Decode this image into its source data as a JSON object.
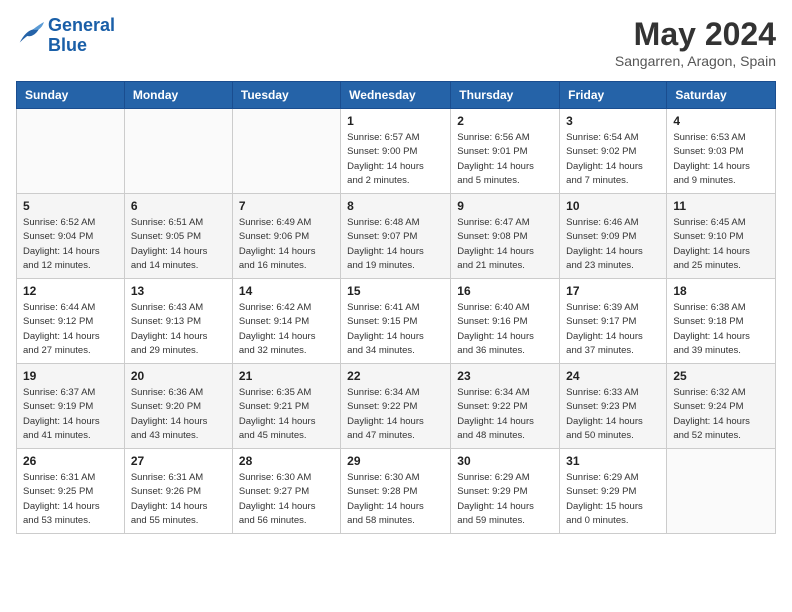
{
  "logo": {
    "line1": "General",
    "line2": "Blue"
  },
  "title": "May 2024",
  "location": "Sangarren, Aragon, Spain",
  "days_header": [
    "Sunday",
    "Monday",
    "Tuesday",
    "Wednesday",
    "Thursday",
    "Friday",
    "Saturday"
  ],
  "weeks": [
    [
      {
        "day": "",
        "info": ""
      },
      {
        "day": "",
        "info": ""
      },
      {
        "day": "",
        "info": ""
      },
      {
        "day": "1",
        "info": "Sunrise: 6:57 AM\nSunset: 9:00 PM\nDaylight: 14 hours\nand 2 minutes."
      },
      {
        "day": "2",
        "info": "Sunrise: 6:56 AM\nSunset: 9:01 PM\nDaylight: 14 hours\nand 5 minutes."
      },
      {
        "day": "3",
        "info": "Sunrise: 6:54 AM\nSunset: 9:02 PM\nDaylight: 14 hours\nand 7 minutes."
      },
      {
        "day": "4",
        "info": "Sunrise: 6:53 AM\nSunset: 9:03 PM\nDaylight: 14 hours\nand 9 minutes."
      }
    ],
    [
      {
        "day": "5",
        "info": "Sunrise: 6:52 AM\nSunset: 9:04 PM\nDaylight: 14 hours\nand 12 minutes."
      },
      {
        "day": "6",
        "info": "Sunrise: 6:51 AM\nSunset: 9:05 PM\nDaylight: 14 hours\nand 14 minutes."
      },
      {
        "day": "7",
        "info": "Sunrise: 6:49 AM\nSunset: 9:06 PM\nDaylight: 14 hours\nand 16 minutes."
      },
      {
        "day": "8",
        "info": "Sunrise: 6:48 AM\nSunset: 9:07 PM\nDaylight: 14 hours\nand 19 minutes."
      },
      {
        "day": "9",
        "info": "Sunrise: 6:47 AM\nSunset: 9:08 PM\nDaylight: 14 hours\nand 21 minutes."
      },
      {
        "day": "10",
        "info": "Sunrise: 6:46 AM\nSunset: 9:09 PM\nDaylight: 14 hours\nand 23 minutes."
      },
      {
        "day": "11",
        "info": "Sunrise: 6:45 AM\nSunset: 9:10 PM\nDaylight: 14 hours\nand 25 minutes."
      }
    ],
    [
      {
        "day": "12",
        "info": "Sunrise: 6:44 AM\nSunset: 9:12 PM\nDaylight: 14 hours\nand 27 minutes."
      },
      {
        "day": "13",
        "info": "Sunrise: 6:43 AM\nSunset: 9:13 PM\nDaylight: 14 hours\nand 29 minutes."
      },
      {
        "day": "14",
        "info": "Sunrise: 6:42 AM\nSunset: 9:14 PM\nDaylight: 14 hours\nand 32 minutes."
      },
      {
        "day": "15",
        "info": "Sunrise: 6:41 AM\nSunset: 9:15 PM\nDaylight: 14 hours\nand 34 minutes."
      },
      {
        "day": "16",
        "info": "Sunrise: 6:40 AM\nSunset: 9:16 PM\nDaylight: 14 hours\nand 36 minutes."
      },
      {
        "day": "17",
        "info": "Sunrise: 6:39 AM\nSunset: 9:17 PM\nDaylight: 14 hours\nand 37 minutes."
      },
      {
        "day": "18",
        "info": "Sunrise: 6:38 AM\nSunset: 9:18 PM\nDaylight: 14 hours\nand 39 minutes."
      }
    ],
    [
      {
        "day": "19",
        "info": "Sunrise: 6:37 AM\nSunset: 9:19 PM\nDaylight: 14 hours\nand 41 minutes."
      },
      {
        "day": "20",
        "info": "Sunrise: 6:36 AM\nSunset: 9:20 PM\nDaylight: 14 hours\nand 43 minutes."
      },
      {
        "day": "21",
        "info": "Sunrise: 6:35 AM\nSunset: 9:21 PM\nDaylight: 14 hours\nand 45 minutes."
      },
      {
        "day": "22",
        "info": "Sunrise: 6:34 AM\nSunset: 9:22 PM\nDaylight: 14 hours\nand 47 minutes."
      },
      {
        "day": "23",
        "info": "Sunrise: 6:34 AM\nSunset: 9:22 PM\nDaylight: 14 hours\nand 48 minutes."
      },
      {
        "day": "24",
        "info": "Sunrise: 6:33 AM\nSunset: 9:23 PM\nDaylight: 14 hours\nand 50 minutes."
      },
      {
        "day": "25",
        "info": "Sunrise: 6:32 AM\nSunset: 9:24 PM\nDaylight: 14 hours\nand 52 minutes."
      }
    ],
    [
      {
        "day": "26",
        "info": "Sunrise: 6:31 AM\nSunset: 9:25 PM\nDaylight: 14 hours\nand 53 minutes."
      },
      {
        "day": "27",
        "info": "Sunrise: 6:31 AM\nSunset: 9:26 PM\nDaylight: 14 hours\nand 55 minutes."
      },
      {
        "day": "28",
        "info": "Sunrise: 6:30 AM\nSunset: 9:27 PM\nDaylight: 14 hours\nand 56 minutes."
      },
      {
        "day": "29",
        "info": "Sunrise: 6:30 AM\nSunset: 9:28 PM\nDaylight: 14 hours\nand 58 minutes."
      },
      {
        "day": "30",
        "info": "Sunrise: 6:29 AM\nSunset: 9:29 PM\nDaylight: 14 hours\nand 59 minutes."
      },
      {
        "day": "31",
        "info": "Sunrise: 6:29 AM\nSunset: 9:29 PM\nDaylight: 15 hours\nand 0 minutes."
      },
      {
        "day": "",
        "info": ""
      }
    ]
  ]
}
